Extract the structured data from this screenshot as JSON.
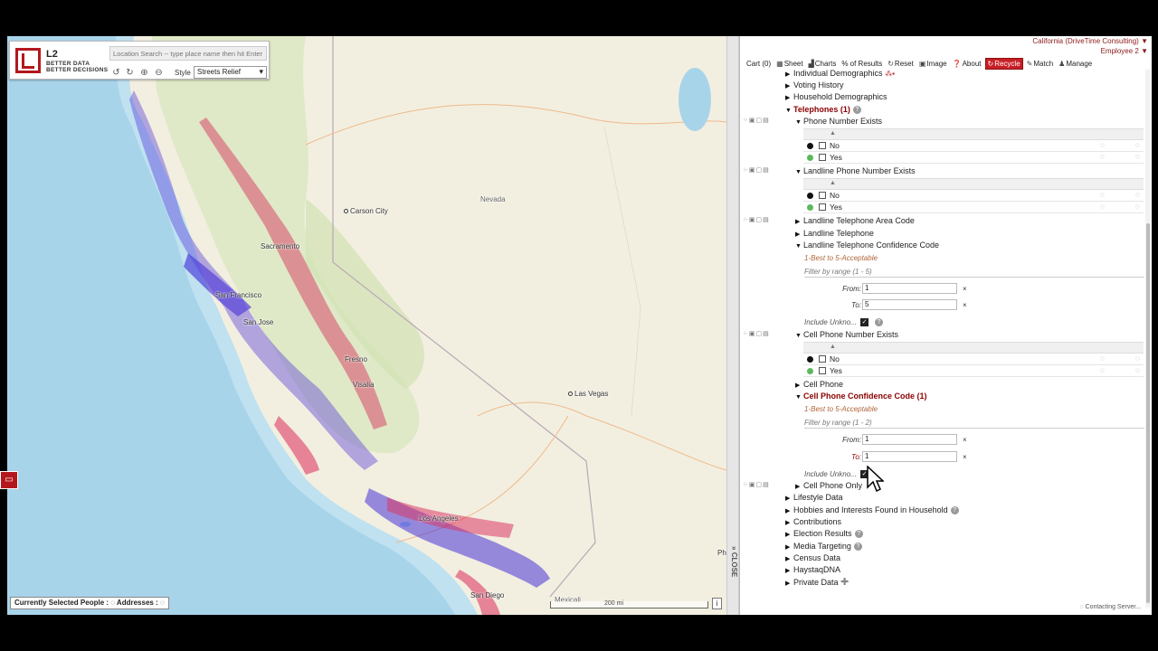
{
  "map": {
    "logo_text": "L2",
    "logo_tagline_1": "BETTER DATA",
    "logo_tagline_2": "BETTER DECISIONS",
    "search_placeholder": "Location Search -- type place name then hit Enter",
    "style_label": "Style",
    "style_value": "Streets Relief",
    "tool_icons": [
      "rotate-left-icon",
      "rotate-right-icon",
      "zoom-in-icon",
      "zoom-out-icon"
    ],
    "labels": {
      "carson_city": "Carson City",
      "nevada": "Nevada",
      "sacramento": "Sacramento",
      "san_francisco": "San Francisco",
      "san_jose": "San Jose",
      "fresno": "Fresno",
      "visalia": "Visalia",
      "las_vegas": "Las Vegas",
      "los_angeles": "Los Angeles",
      "san_diego": "San Diego",
      "mexicali": "Mexicali",
      "phoenix_partial": "Ph"
    },
    "scale_text": "200 mi",
    "status_bar": "Currently Selected People : ◌ Addresses : ◌",
    "info_button": "i",
    "colors": {
      "water": "#a7d3ea",
      "land": "#f2efe1",
      "green": "#dfe9c6",
      "dot_red": "#d81a4f",
      "dot_blue": "#3b25d6"
    }
  },
  "splitter": {
    "close_label": "CLOSE",
    "chevron": "»"
  },
  "panel": {
    "account": "California (DriveTime Consulting)",
    "user": "Employee 2",
    "toolbar": [
      {
        "id": "cart",
        "label": "Cart (0)",
        "icon": ""
      },
      {
        "id": "sheet",
        "label": "Sheet",
        "icon": "▦"
      },
      {
        "id": "charts",
        "label": "Charts",
        "icon": "▟"
      },
      {
        "id": "percent",
        "label": "% of Results",
        "icon": ""
      },
      {
        "id": "reset",
        "label": "Reset",
        "icon": "↻"
      },
      {
        "id": "image",
        "label": "Image",
        "icon": "▣"
      },
      {
        "id": "about",
        "label": "About",
        "icon": "❓"
      },
      {
        "id": "recycle",
        "label": "Recycle",
        "icon": "↻"
      },
      {
        "id": "match",
        "label": "Match",
        "icon": "✎"
      },
      {
        "id": "manage",
        "label": "Manage",
        "icon": "♟"
      }
    ],
    "tree": {
      "individual_demographics": "Individual Demographics",
      "voting_history": "Voting History",
      "household_demographics": "Household Demographics",
      "telephones": "Telephones (1)",
      "phone_number_exists": "Phone Number Exists",
      "landline_phone_number_exists": "Landline Phone Number Exists",
      "landline_area_code": "Landline Telephone Area Code",
      "landline_telephone": "Landline Telephone",
      "landline_confidence_code": "Landline Telephone Confidence Code",
      "cell_phone_number_exists": "Cell Phone Number Exists",
      "cell_phone": "Cell Phone",
      "cell_confidence_code": "Cell Phone Confidence Code (1)",
      "cell_phone_only": "Cell Phone Only",
      "lifestyle_data": "Lifestyle Data",
      "hobbies": "Hobbies and Interests Found in Household",
      "contributions": "Contributions",
      "election_results": "Election Results",
      "media_targeting": "Media Targeting",
      "census_data": "Census Data",
      "haystaq": "HaystaqDNA",
      "private_data": "Private Data"
    },
    "options": {
      "no": "No",
      "yes": "Yes"
    },
    "confidence_note": "1-Best to 5-Acceptable",
    "landline_filter_hint": "Filter by range (1 - 5)",
    "cell_filter_hint": "Filter by range (1 - 2)",
    "from_label": "From:",
    "to_label": "To:",
    "landline_from": "1",
    "landline_to": "5",
    "cell_from": "1",
    "cell_to": "1",
    "include_unknown": "Include Unkno...",
    "clear_x": "×",
    "contacting": "◌ Contacting Server..."
  }
}
